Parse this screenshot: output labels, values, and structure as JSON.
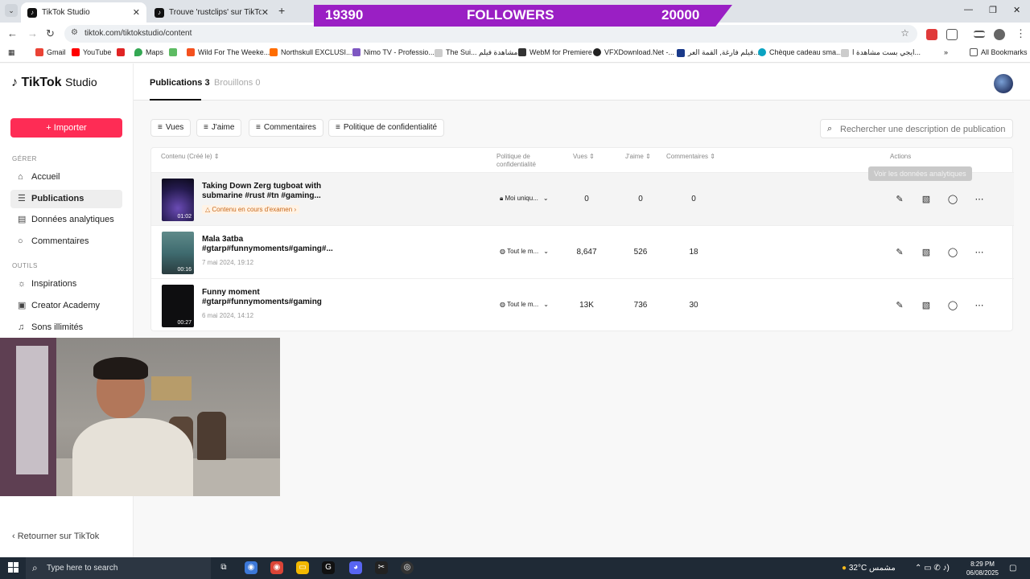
{
  "browser": {
    "tabs": [
      {
        "title": "TikTok Studio",
        "active": true
      },
      {
        "title": "Trouve 'rustclips' sur TikTok | Re",
        "active": false
      }
    ],
    "new_tab": "+",
    "url": "tiktok.com/tiktokstudio/content",
    "bookmarks": [
      "Gmail",
      "YouTube",
      "Maps",
      "Wild For The Weeke...",
      "Northskull EXCLUSI...",
      "Nimo TV - Professio...",
      "The Sui... مشاهدة فيلم",
      "WebM for Premiere",
      "VFXDownload.Net -...",
      "فيلم فارغة, القمة العر...",
      "Chèque cadeau sma...",
      "ايجي بست مشاهدة ا...",
      "All Bookmarks"
    ]
  },
  "overlay": {
    "followers_current": "19390",
    "followers_label": "FOLLOWERS",
    "followers_goal": "20000"
  },
  "sidebar": {
    "logo": "TikTok",
    "logo_suffix": "Studio",
    "import_label": "Importer",
    "section_manage": "GÉRER",
    "section_tools": "OUTILS",
    "manage_items": [
      "Accueil",
      "Publications",
      "Données analytiques",
      "Commentaires"
    ],
    "tool_items": [
      "Inspirations",
      "Creator Academy",
      "Sons illimités"
    ],
    "back_link": "Retourner sur TikTok"
  },
  "main": {
    "tabs": [
      {
        "label": "Publications 3",
        "active": true
      },
      {
        "label": "Brouillons 0",
        "active": false
      }
    ],
    "filters": [
      "Vues",
      "J'aime",
      "Commentaires",
      "Politique de confidentialité"
    ],
    "search_placeholder": "Rechercher une description de publication",
    "columns": {
      "content": "Contenu (Créé le)",
      "privacy": "Politique de confidentialité",
      "views": "Vues",
      "likes": "J'aime",
      "comments": "Commentaires",
      "actions": "Actions"
    },
    "rows": [
      {
        "duration": "01:02",
        "title": "Taking Down Zerg tugboat with submarine #rust #tn #gaming...",
        "status": "Contenu en cours d'examen",
        "date": "",
        "privacy": "Moi uniqu...",
        "views": "0",
        "likes": "0",
        "comments": "0"
      },
      {
        "duration": "00:16",
        "title": "Mala 3atba #gtarp#funnymoments#gaming#...",
        "status": "",
        "date": "7 mai 2024, 19:12",
        "privacy": "Tout le m...",
        "views": "8,647",
        "likes": "526",
        "comments": "18"
      },
      {
        "duration": "00:27",
        "title": "Funny moment #gtarp#funnymoments#gaming",
        "status": "",
        "date": "6 mai 2024, 14:12",
        "privacy": "Tout le m...",
        "views": "13K",
        "likes": "736",
        "comments": "30"
      }
    ],
    "tooltip": "Voir les données analytiques"
  },
  "taskbar": {
    "search_placeholder": "Type here to search",
    "weather": "32°C  مشمس",
    "time": "8:29 PM",
    "date": "06/08/2025"
  },
  "colors": {
    "accent": "#fe2c55",
    "banner": "#9a1fc4",
    "review": "#c8691c"
  }
}
